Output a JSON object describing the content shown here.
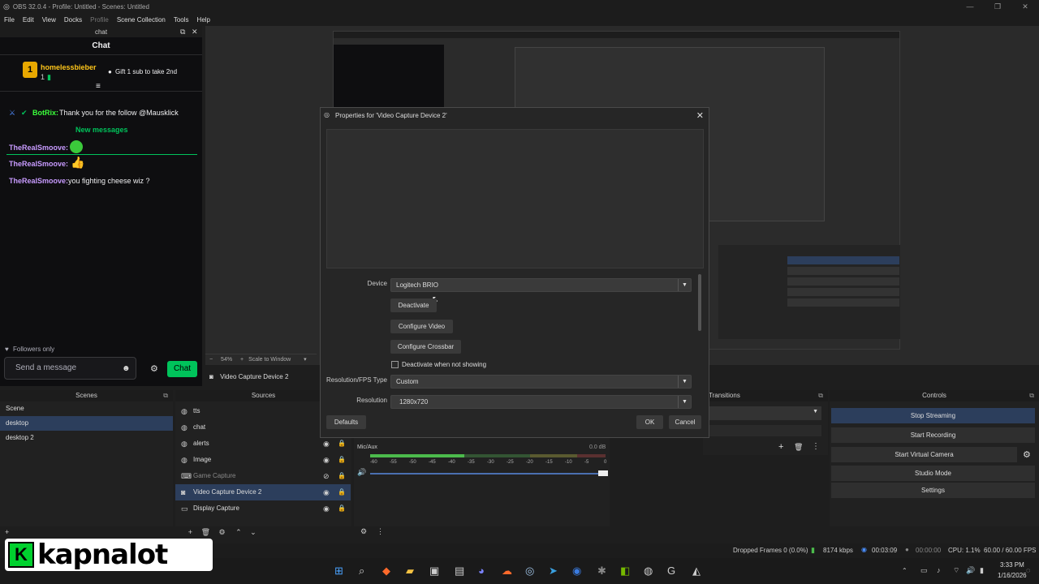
{
  "window": {
    "title": "OBS 32.0.4 - Profile: Untitled - Scenes: Untitled"
  },
  "menu": [
    "File",
    "Edit",
    "View",
    "Docks",
    "Profile",
    "Scene Collection",
    "Tools",
    "Help"
  ],
  "chat_dock": {
    "dock_title": "chat",
    "header": "Chat",
    "pinned": {
      "user": "homelessbieber",
      "count": "1",
      "gift_text": "Gift 1 sub to take 2nd"
    },
    "messages": [
      {
        "user": "BotRix:",
        "text": "Thank you for the follow @Mausklick",
        "color": "#3bff3b"
      },
      {
        "user": "TheRealSmoove:",
        "text": "",
        "color": "#c89bff"
      },
      {
        "user": "TheRealSmoove:",
        "text": "",
        "color": "#c89bff"
      },
      {
        "user": "TheRealSmoove:",
        "text": "you fighting cheese wiz ?",
        "color": "#c89bff"
      }
    ],
    "new_messages": "New messages",
    "followers_only": "Followers only",
    "input_placeholder": "Send a message",
    "send_label": "Chat"
  },
  "preview_bar": {
    "zoom": "54%",
    "scale": "Scale to Window",
    "source_label": "Video Capture Device 2"
  },
  "dialog": {
    "title": "Properties for 'Video Capture Device 2'",
    "device_label": "Device",
    "device_value": "Logitech BRIO",
    "deactivate": "Deactivate",
    "configure_video": "Configure Video",
    "configure_crossbar": "Configure Crossbar",
    "deactivate_when_hidden": "Deactivate when not showing",
    "res_type_label": "Resolution/FPS Type",
    "res_type_value": "Custom",
    "resolution_label": "Resolution",
    "resolution_value": "1280x720",
    "defaults": "Defaults",
    "ok": "OK",
    "cancel": "Cancel"
  },
  "scenes": {
    "title": "Scenes",
    "items": [
      "Scene",
      "desktop",
      "desktop 2"
    ],
    "selected": 1
  },
  "sources": {
    "title": "Sources",
    "items": [
      "tts",
      "chat",
      "alerts",
      "Image",
      "Game Capture",
      "Video Capture Device 2",
      "Display Capture"
    ]
  },
  "audio": {
    "channel": "Mic/Aux",
    "level": "0.0 dB",
    "ticks": [
      "-60",
      "-55",
      "-50",
      "-45",
      "-40",
      "-35",
      "-30",
      "-25",
      "-20",
      "-15",
      "-10",
      "-5",
      "0"
    ]
  },
  "transitions": {
    "title": "Transitions"
  },
  "controls": {
    "title": "Controls",
    "buttons": [
      "Stop Streaming",
      "Start Recording",
      "Start Virtual Camera",
      "Studio Mode",
      "Settings"
    ]
  },
  "status": {
    "dropped": "Dropped Frames 0 (0.0%)",
    "kbps": "8174 kbps",
    "stream_time": "00:03:09",
    "rec_time": "00:00:00",
    "cpu": "CPU: 1.1%",
    "fps": "60.00 / 60.00 FPS"
  },
  "taskbar": {
    "time": "3:33 PM",
    "date": "1/16/2026"
  },
  "watermark": {
    "text": "kapnalot"
  }
}
